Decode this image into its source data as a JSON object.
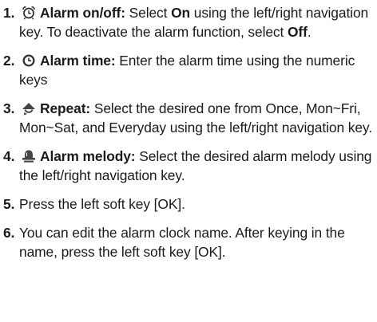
{
  "steps": [
    {
      "number": "1.",
      "icon": "alarm-clock-icon",
      "label": "Alarm on/off:",
      "text_before": " Select ",
      "bold1": "On",
      "text_middle": " using the left/right navigation key. To deactivate the alarm function, select ",
      "bold2": "Off",
      "text_after": "."
    },
    {
      "number": "2.",
      "icon": "clock-icon",
      "label": "Alarm time:",
      "text": " Enter the alarm time using the numeric keys"
    },
    {
      "number": "3.",
      "icon": "repeat-icon",
      "label": "Repeat:",
      "text": " Select the desired one from Once, Mon~Fri, Mon~Sat, and Everyday using the left/right navigation key."
    },
    {
      "number": "4.",
      "icon": "bell-icon",
      "label": "Alarm melody:",
      "text": " Select the desired alarm melody using the left/right navigation key."
    },
    {
      "number": "5.",
      "text": "Press the left soft key [OK]."
    },
    {
      "number": "6.",
      "text": "You can edit the alarm clock name. After keying in the name, press the left soft key [OK]."
    }
  ]
}
